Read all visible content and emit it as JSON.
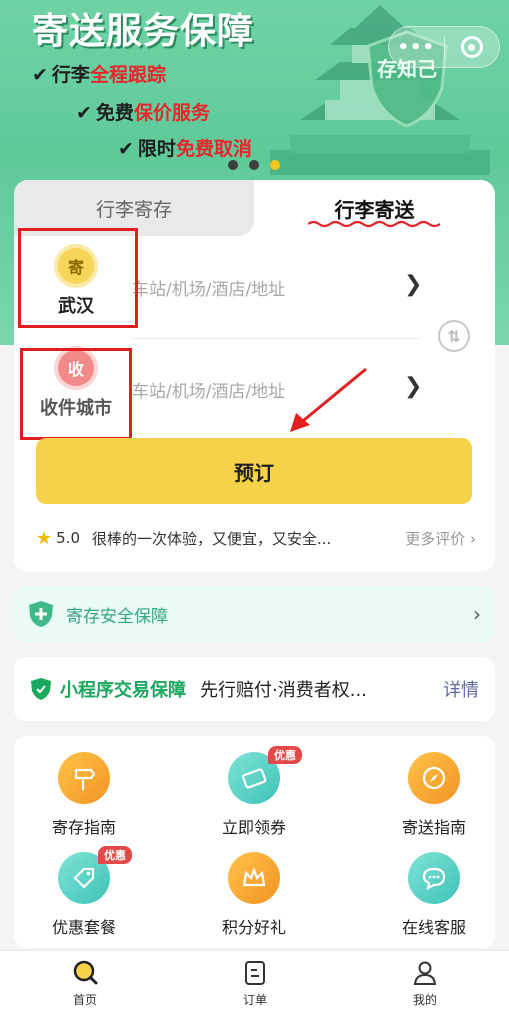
{
  "banner": {
    "title": "寄送服务保障",
    "features": [
      {
        "prefix": "行李",
        "highlight": "全程跟踪",
        "suffix": ""
      },
      {
        "prefix": "免费",
        "highlight": "保价服务",
        "suffix": ""
      },
      {
        "prefix": "限时",
        "highlight": "免费取消",
        "suffix": ""
      }
    ],
    "shield_text": "存知己",
    "active_slide": 3,
    "slide_count": 3,
    "menu_label": "•••"
  },
  "tabs": [
    {
      "label": "行李寄存",
      "active": false
    },
    {
      "label": "行李寄送",
      "active": true
    }
  ],
  "send": {
    "badge": "寄",
    "city": "武汉",
    "placeholder": "车站/机场/酒店/地址"
  },
  "receive": {
    "badge": "收",
    "city": "收件城市",
    "placeholder": "车站/机场/酒店/地址"
  },
  "book_button": "预订",
  "review": {
    "score": "5.0",
    "text": "很棒的一次体验，又便宜，又安全...",
    "more": "更多评价"
  },
  "safety": {
    "label": "寄存安全保障"
  },
  "guarantee": {
    "title": "小程序交易保障",
    "desc": "先行赔付·消费者权...",
    "link": "详情"
  },
  "services": [
    {
      "label": "寄存指南",
      "icon": "signpost-icon",
      "tag": ""
    },
    {
      "label": "立即领券",
      "icon": "coupon-icon",
      "tag": "优惠"
    },
    {
      "label": "寄送指南",
      "icon": "compass-icon",
      "tag": ""
    },
    {
      "label": "优惠套餐",
      "icon": "price-tag-icon",
      "tag": "优惠"
    },
    {
      "label": "积分好礼",
      "icon": "crown-icon",
      "tag": ""
    },
    {
      "label": "在线客服",
      "icon": "chat-icon",
      "tag": ""
    }
  ],
  "nav": [
    {
      "label": "首页",
      "icon": "search-home-icon",
      "active": true
    },
    {
      "label": "订单",
      "icon": "order-icon",
      "active": false
    },
    {
      "label": "我的",
      "icon": "user-icon",
      "active": false
    }
  ],
  "colors": {
    "banner_green": "#5fc99a",
    "accent_yellow": "#f5d24a",
    "highlight_red": "#e8262b",
    "annotation_red": "#e02020",
    "safety_green": "#36a67e",
    "guarantee_green": "#19a85d"
  }
}
